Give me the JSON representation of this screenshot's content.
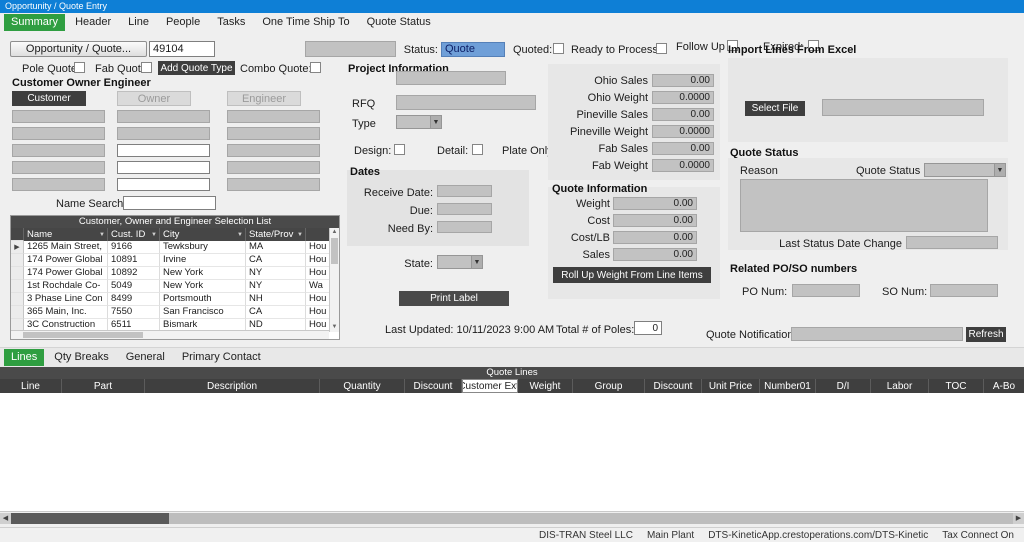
{
  "colors": {
    "title_bar": "#0e7fd6",
    "accent_green": "#2f9e41",
    "dark_button": "#3e3e3e",
    "status_field_blue": "#6f9fd8"
  },
  "window": {
    "title": "Opportunity / Quote Entry"
  },
  "top_tabs": [
    "Summary",
    "Header",
    "Line",
    "People",
    "Tasks",
    "One Time Ship To",
    "Quote Status"
  ],
  "header": {
    "opportunity_button": "Opportunity / Quote...",
    "opportunity_number": "49104",
    "status_label": "Status:",
    "status_value": "Quote",
    "quoted_label": "Quoted:",
    "ready_to_process_label": "Ready to Process:",
    "follow_up_label": "Follow Up",
    "expired_label": "Expired:",
    "pole_quote_label": "Pole Quote:",
    "fab_quote_label": "Fab Quote:",
    "add_quote_type_button": "Add Quote Type",
    "combo_quote_label": "Combo Quote:"
  },
  "customer_section": {
    "title": "Customer Owner Engineer",
    "customer_button": "Customer",
    "owner_button": "Owner",
    "engineer_button": "Engineer",
    "name_search_label": "Name Search:",
    "selection_list": {
      "title": "Customer, Owner and Engineer Selection List",
      "columns": [
        "Name",
        "Cust. ID",
        "City",
        "State/Prov"
      ],
      "rows": [
        [
          "1265 Main Street,",
          "9166",
          "Tewksbury",
          "MA",
          "Hou"
        ],
        [
          "174 Power Global",
          "10891",
          "Irvine",
          "CA",
          "Hou"
        ],
        [
          "174 Power Global",
          "10892",
          "New York",
          "NY",
          "Hou"
        ],
        [
          "1st Rochdale Co-",
          "5049",
          "New York",
          "NY",
          "Wa"
        ],
        [
          "3 Phase Line Con",
          "8499",
          "Portsmouth",
          "NH",
          "Hou"
        ],
        [
          "365 Main, Inc.",
          "7550",
          "San Francisco",
          "CA",
          "Hou"
        ],
        [
          "3C Construction",
          "6511",
          "Bismark",
          "ND",
          "Hou"
        ]
      ]
    }
  },
  "project_information": {
    "title": "Project Information",
    "rfq_label": "RFQ",
    "type_label": "Type",
    "design_label": "Design:",
    "detail_label": "Detail:",
    "plate_only_label": "Plate Only:"
  },
  "dates": {
    "title": "Dates",
    "receive_date_label": "Receive Date:",
    "due_label": "Due:",
    "need_by_label": "Need By:",
    "state_label": "State:",
    "print_label_button": "Print Label"
  },
  "sales_summary": {
    "rows": [
      {
        "label": "Ohio Sales",
        "value": "0.00"
      },
      {
        "label": "Ohio Weight",
        "value": "0.0000"
      },
      {
        "label": "Pineville Sales",
        "value": "0.00"
      },
      {
        "label": "Pineville Weight",
        "value": "0.0000"
      },
      {
        "label": "Fab Sales",
        "value": "0.00"
      },
      {
        "label": "Fab Weight",
        "value": "0.0000"
      }
    ]
  },
  "quote_information": {
    "title": "Quote Information",
    "rows": [
      {
        "label": "Weight",
        "value": "0.00"
      },
      {
        "label": "Cost",
        "value": "0.00"
      },
      {
        "label": "Cost/LB",
        "value": "0.00"
      },
      {
        "label": "Sales",
        "value": "0.00"
      }
    ],
    "rollup_button": "Roll Up Weight From Line Items"
  },
  "import_excel": {
    "title": "Import Lines From Excel",
    "select_file_button": "Select File"
  },
  "quote_status_panel": {
    "title": "Quote Status",
    "reason_label": "Reason",
    "quote_status_label": "Quote Status",
    "last_status_label": "Last Status Date Change"
  },
  "related_numbers": {
    "title": "Related PO/SO numbers",
    "po_label": "PO Num:",
    "so_label": "SO Num:"
  },
  "misc": {
    "last_updated": "Last Updated: 10/11/2023 9:00 AM",
    "total_poles_label": "Total # of Poles:",
    "total_poles_value": "0",
    "quote_notifications_label": "Quote Notifications:",
    "refresh_button": "Refresh"
  },
  "bottom_tabs": [
    "Lines",
    "Qty Breaks",
    "General",
    "Primary Contact"
  ],
  "quote_lines": {
    "title": "Quote Lines",
    "columns": [
      "Line",
      "Part",
      "Description",
      "Quantity",
      "Discount",
      "Customer Ext.",
      "Weight",
      "Group",
      "Discount",
      "Unit Price",
      "Number01",
      "D/I",
      "Labor",
      "TOC",
      "A-Bo"
    ]
  },
  "status_bar": {
    "items": [
      "DIS-TRAN Steel LLC",
      "Main Plant",
      "DTS-KineticApp.crestoperations.com/DTS-Kinetic",
      "Tax Connect On"
    ]
  }
}
